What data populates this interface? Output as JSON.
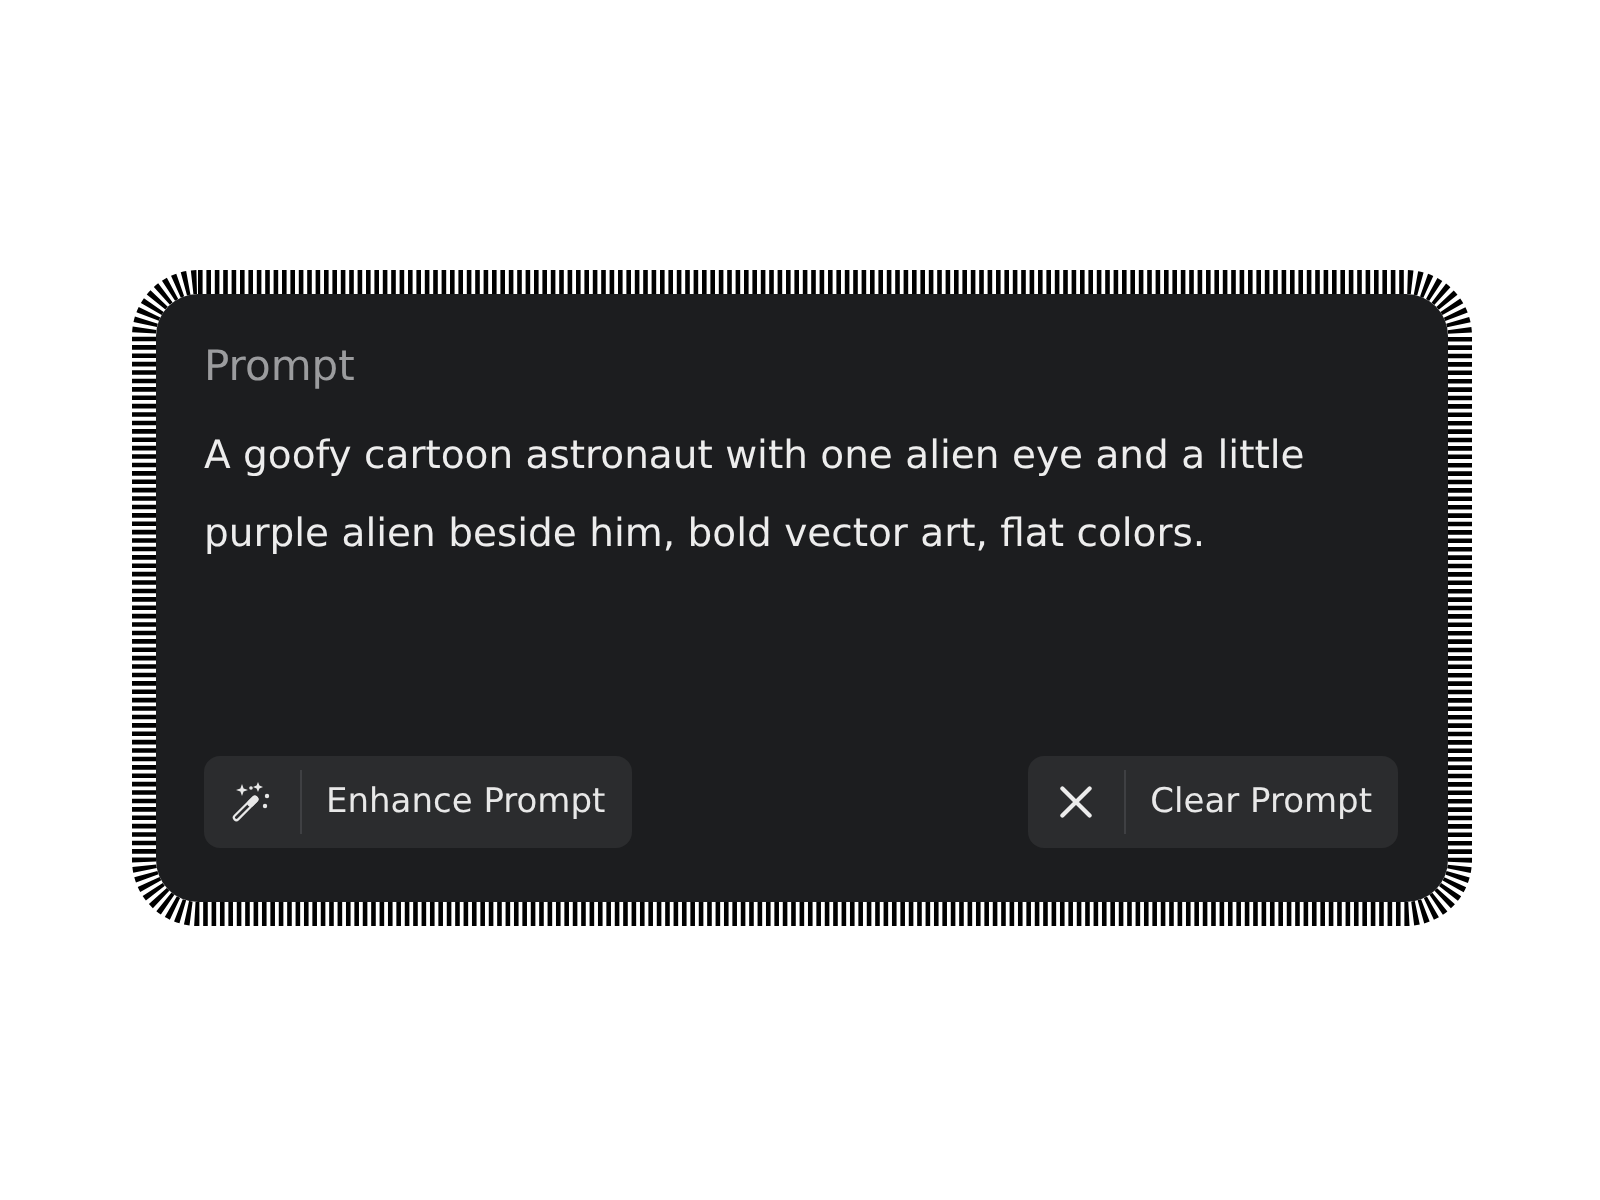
{
  "prompt": {
    "label": "Prompt",
    "text": "A goofy cartoon astronaut with one alien eye and a little purple alien beside him, bold vector art, flat colors.",
    "buttons": [
      {
        "kind": "enhance",
        "label": "Enhance Prompt"
      },
      {
        "kind": "clear",
        "label": "Clear Prompt"
      }
    ]
  }
}
